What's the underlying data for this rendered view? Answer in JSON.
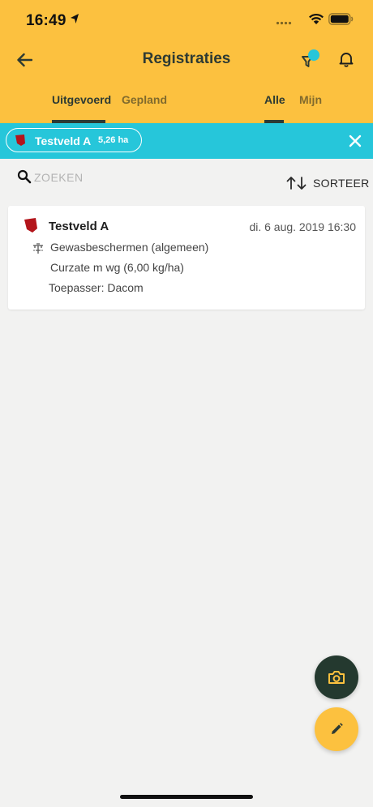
{
  "status_bar": {
    "time": "16:49"
  },
  "header": {
    "title": "Registraties",
    "tabs_left": [
      {
        "label": "Uitgevoerd",
        "active": true
      },
      {
        "label": "Gepland",
        "active": false
      }
    ],
    "tabs_right": [
      {
        "label": "Alle",
        "active": true
      },
      {
        "label": "Mijn",
        "active": false
      }
    ]
  },
  "filter": {
    "field_name": "Testveld A",
    "field_area": "5,26 ha"
  },
  "search": {
    "placeholder": "ZOEKEN",
    "value": ""
  },
  "sort": {
    "label": "SORTEER"
  },
  "registrations": [
    {
      "field": "Testveld A",
      "date": "di. 6 aug. 2019 16:30",
      "activity": "Gewasbeschermen (algemeen)",
      "product": "Curzate m wg (6,00 kg/ha)",
      "applicator": "Toepasser: Dacom"
    }
  ],
  "colors": {
    "header": "#fcc13f",
    "filter_bar": "#26c6da",
    "field_icon": "#b3151b",
    "fab_camera": "#24392f",
    "fab_edit": "#fcc13f"
  },
  "icons": {
    "back": "arrow-left-icon",
    "filter": "filter-icon",
    "notifications": "bell-icon",
    "close": "close-icon",
    "search": "search-icon",
    "sort": "sort-arrows-icon",
    "camera": "camera-icon",
    "edit": "pencil-icon"
  }
}
